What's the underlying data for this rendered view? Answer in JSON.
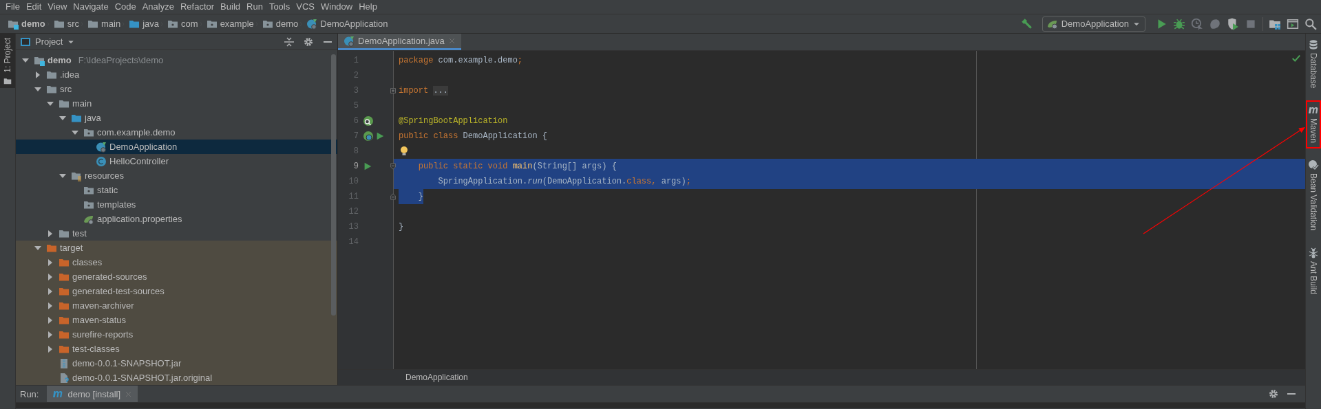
{
  "menu": [
    "File",
    "Edit",
    "View",
    "Navigate",
    "Code",
    "Analyze",
    "Refactor",
    "Build",
    "Run",
    "Tools",
    "VCS",
    "Window",
    "Help"
  ],
  "breadcrumbs": [
    {
      "label": "demo",
      "kind": "module"
    },
    {
      "label": "src",
      "kind": "folder"
    },
    {
      "label": "main",
      "kind": "folder"
    },
    {
      "label": "java",
      "kind": "source"
    },
    {
      "label": "com",
      "kind": "package"
    },
    {
      "label": "example",
      "kind": "package"
    },
    {
      "label": "demo",
      "kind": "package"
    },
    {
      "label": "DemoApplication",
      "kind": "spring-class"
    }
  ],
  "toolbar": [
    {
      "kind": "build",
      "disabled": false
    },
    {
      "kind": "run-config",
      "label": "DemoApplication"
    },
    {
      "kind": "run",
      "disabled": false
    },
    {
      "kind": "debug",
      "disabled": false
    },
    {
      "kind": "coverage",
      "disabled": true
    },
    {
      "kind": "profile",
      "disabled": true
    },
    {
      "kind": "shield-run",
      "disabled": false
    },
    {
      "kind": "stop",
      "disabled": true
    },
    {
      "kind": "separator"
    },
    {
      "kind": "structure"
    },
    {
      "kind": "layout"
    },
    {
      "kind": "search"
    }
  ],
  "left_strip": [
    {
      "label": "1: Project",
      "selected": true
    }
  ],
  "project": {
    "title": "Project",
    "tree": [
      {
        "label": "demo",
        "path": "F:\\IdeaProjects\\demo",
        "kind": "module",
        "expanded": true,
        "selected": false,
        "excluded": false,
        "children": [
          {
            "label": ".idea",
            "kind": "folder",
            "expanded": false,
            "selected": false,
            "excluded": false
          },
          {
            "label": "src",
            "kind": "folder",
            "expanded": true,
            "selected": false,
            "excluded": false,
            "children": [
              {
                "label": "main",
                "kind": "folder",
                "expanded": true,
                "selected": false,
                "excluded": false,
                "children": [
                  {
                    "label": "java",
                    "kind": "source",
                    "expanded": true,
                    "selected": false,
                    "excluded": false,
                    "children": [
                      {
                        "label": "com.example.demo",
                        "kind": "package",
                        "expanded": true,
                        "selected": false,
                        "excluded": false,
                        "children": [
                          {
                            "label": "DemoApplication",
                            "kind": "spring-class",
                            "selected": true,
                            "excluded": false
                          },
                          {
                            "label": "HelloController",
                            "kind": "class",
                            "selected": false,
                            "excluded": false
                          }
                        ]
                      }
                    ]
                  },
                  {
                    "label": "resources",
                    "kind": "resources",
                    "expanded": true,
                    "selected": false,
                    "excluded": false,
                    "children": [
                      {
                        "label": "static",
                        "kind": "package",
                        "selected": false,
                        "excluded": false
                      },
                      {
                        "label": "templates",
                        "kind": "package",
                        "selected": false,
                        "excluded": false
                      },
                      {
                        "label": "application.properties",
                        "kind": "spring-config",
                        "selected": false,
                        "excluded": false
                      }
                    ]
                  }
                ]
              },
              {
                "label": "test",
                "kind": "folder",
                "expanded": false,
                "selected": false,
                "excluded": false
              }
            ]
          },
          {
            "label": "target",
            "kind": "excluded-folder",
            "expanded": true,
            "selected": false,
            "excluded": true,
            "children": [
              {
                "label": "classes",
                "kind": "excluded-folder",
                "expanded": false,
                "selected": false,
                "excluded": true
              },
              {
                "label": "generated-sources",
                "kind": "excluded-folder",
                "expanded": false,
                "selected": false,
                "excluded": true
              },
              {
                "label": "generated-test-sources",
                "kind": "excluded-folder",
                "expanded": false,
                "selected": false,
                "excluded": true
              },
              {
                "label": "maven-archiver",
                "kind": "excluded-folder",
                "expanded": false,
                "selected": false,
                "excluded": true
              },
              {
                "label": "maven-status",
                "kind": "excluded-folder",
                "expanded": false,
                "selected": false,
                "excluded": true
              },
              {
                "label": "surefire-reports",
                "kind": "excluded-folder",
                "expanded": false,
                "selected": false,
                "excluded": true
              },
              {
                "label": "test-classes",
                "kind": "excluded-folder",
                "expanded": false,
                "selected": false,
                "excluded": true
              },
              {
                "label": "demo-0.0.1-SNAPSHOT.jar",
                "kind": "jar",
                "selected": false,
                "excluded": true
              },
              {
                "label": "demo-0.0.1-SNAPSHOT.jar.original",
                "kind": "unknown-file",
                "selected": false,
                "excluded": true
              }
            ]
          }
        ]
      }
    ]
  },
  "editor": {
    "tab": {
      "label": "DemoApplication.java",
      "selected": true
    },
    "lines": [
      {
        "number": "1",
        "current": false,
        "selected": false,
        "tokens": [
          {
            "kind": "keyword",
            "text": "package"
          },
          {
            "kind": "text",
            "text": " com.example.demo"
          },
          {
            "kind": "keyword",
            "text": ";"
          }
        ]
      },
      {
        "number": "2",
        "current": false,
        "selected": false
      },
      {
        "number": "3",
        "current": false,
        "selected": false,
        "gutter": [
          {
            "kind": "fold-expand"
          }
        ],
        "tokens": [
          {
            "kind": "keyword",
            "text": "import "
          },
          {
            "kind": "folded",
            "text": "..."
          }
        ]
      },
      {
        "number": "5",
        "current": false,
        "selected": false
      },
      {
        "number": "6",
        "current": false,
        "selected": false,
        "gutter": [
          {
            "kind": "spring-find"
          }
        ],
        "tokens": [
          {
            "kind": "annotation",
            "text": "@SpringBootApplication"
          }
        ]
      },
      {
        "number": "7",
        "current": false,
        "selected": false,
        "gutter": [
          {
            "kind": "spring-bean"
          },
          {
            "kind": "run"
          }
        ],
        "tokens": [
          {
            "kind": "keyword",
            "text": "public class"
          },
          {
            "kind": "text",
            "text": " DemoApplication {"
          }
        ]
      },
      {
        "number": "8",
        "current": false,
        "selected": false,
        "gutter": [
          {
            "kind": "intention"
          }
        ]
      },
      {
        "number": "9",
        "current": true,
        "selected": true,
        "gutter": [
          {
            "kind": "run"
          },
          {
            "kind": "fold-start"
          }
        ],
        "tokens": [
          {
            "kind": "keyword",
            "text": "    public static void "
          },
          {
            "kind": "method",
            "text": "main"
          },
          {
            "kind": "text",
            "text": "(String[] args) {"
          }
        ]
      },
      {
        "number": "10",
        "current": false,
        "selected": true,
        "tokens": [
          {
            "kind": "text",
            "text": "        SpringApplication."
          },
          {
            "kind": "static-call",
            "text": "run"
          },
          {
            "kind": "text",
            "text": "(DemoApplication."
          },
          {
            "kind": "keyword",
            "text": "class,"
          },
          {
            "kind": "text",
            "text": " args)"
          },
          {
            "kind": "keyword",
            "text": ";"
          }
        ]
      },
      {
        "number": "11",
        "current": false,
        "selected": true,
        "gutter": [
          {
            "kind": "fold-end"
          }
        ],
        "tokens": [
          {
            "kind": "text",
            "text": "    }"
          }
        ]
      },
      {
        "number": "12",
        "current": false,
        "selected": false
      },
      {
        "number": "13",
        "current": false,
        "selected": false,
        "tokens": [
          {
            "kind": "text",
            "text": "}"
          }
        ]
      },
      {
        "number": "14",
        "current": false,
        "selected": false
      }
    ],
    "breadcrumb": "DemoApplication"
  },
  "right_strip": [
    {
      "label": "Database",
      "kind": "database",
      "highlighted": false
    },
    {
      "label": "Maven",
      "kind": "maven",
      "highlighted": true
    },
    {
      "label": "Bean Validation",
      "kind": "bean",
      "highlighted": false
    },
    {
      "label": "Ant Build",
      "kind": "ant",
      "highlighted": false
    }
  ],
  "run_panel": {
    "label": "Run:",
    "tab": {
      "label": "demo [install]",
      "selected": true
    }
  }
}
